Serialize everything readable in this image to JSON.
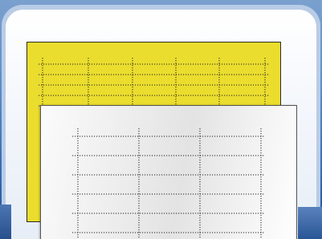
{
  "illustration": {
    "subject": "label-sheets-icon",
    "sheets": [
      {
        "name": "yellow-label-sheet",
        "color": "#ebdd2e",
        "columns": 5,
        "rows": 6
      },
      {
        "name": "white-label-sheet",
        "color": "#f0f0f0",
        "columns": 3,
        "rows": 6
      }
    ],
    "colors": {
      "background": "#5f8ec8",
      "frame": "#b9cce6",
      "panel": "#f4f7fc",
      "gridline": "#222222"
    }
  }
}
